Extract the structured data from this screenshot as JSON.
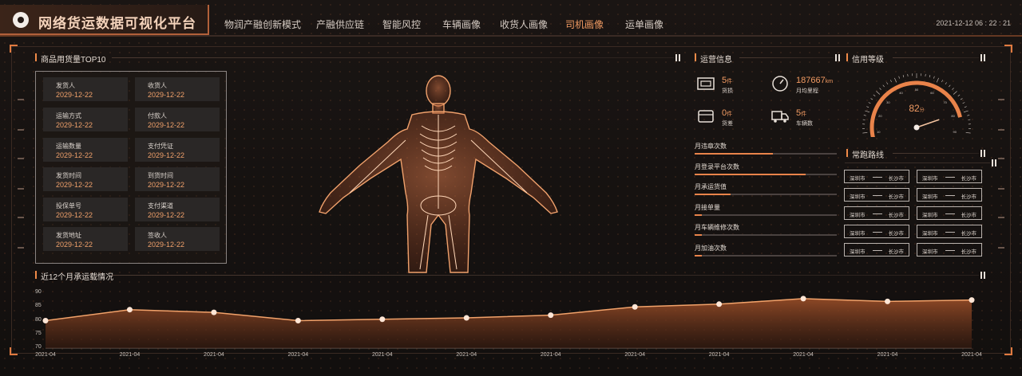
{
  "header": {
    "title": "网络货运数据可视化平台",
    "datetime": "2021-12-12 06 : 22 : 21",
    "nav": [
      {
        "label": "物润产融创新模式",
        "active": false
      },
      {
        "label": "产融供应链",
        "active": false
      },
      {
        "label": "智能风控",
        "active": false
      },
      {
        "label": "车辆画像",
        "active": false
      },
      {
        "label": "收货人画像",
        "active": false
      },
      {
        "label": "司机画像",
        "active": true
      },
      {
        "label": "运单画像",
        "active": false
      }
    ]
  },
  "left_panel": {
    "title": "商品用货量TOP10",
    "cards": [
      {
        "key": "发货人",
        "value": "2029-12-22"
      },
      {
        "key": "收货人",
        "value": "2029-12-22"
      },
      {
        "key": "运输方式",
        "value": "2029-12-22"
      },
      {
        "key": "付款人",
        "value": "2029-12-22"
      },
      {
        "key": "运输数量",
        "value": "2029-12-22"
      },
      {
        "key": "支付凭证",
        "value": "2029-12-22"
      },
      {
        "key": "发货时间",
        "value": "2029-12-22"
      },
      {
        "key": "到货时间",
        "value": "2029-12-22"
      },
      {
        "key": "投保单号",
        "value": "2029-12-22"
      },
      {
        "key": "支付渠道",
        "value": "2029-12-22"
      },
      {
        "key": "发货地址",
        "value": "2029-12-22"
      },
      {
        "key": "签收人",
        "value": "2029-12-22"
      }
    ]
  },
  "ops": {
    "title": "运营信息",
    "stats": [
      {
        "icon": "id-card-icon",
        "value": "5",
        "unit": "件",
        "label": "货损"
      },
      {
        "icon": "speedometer-icon",
        "value": "187667",
        "unit": "km",
        "label": "月均里程"
      },
      {
        "icon": "wallet-icon",
        "value": "0",
        "unit": "件",
        "label": "货差"
      },
      {
        "icon": "truck-icon",
        "value": "5",
        "unit": "件",
        "label": "车辆数"
      }
    ],
    "bars": [
      {
        "label": "月违章次数",
        "fraction": 0.55
      },
      {
        "label": "月登录平台次数",
        "fraction": 0.78
      },
      {
        "label": "月承运货值",
        "fraction": 0.25
      },
      {
        "label": "月接单量",
        "fraction": 0.05
      },
      {
        "label": "月车辆维修次数",
        "fraction": 0.05
      },
      {
        "label": "月加油次数",
        "fraction": 0.05
      }
    ]
  },
  "credit": {
    "title": "信用等级",
    "score": "82",
    "score_unit": "分",
    "score_value": 82,
    "gauge_min": 0,
    "gauge_max": 100,
    "ticks": [
      "0",
      "10",
      "20",
      "30",
      "40",
      "50",
      "60",
      "70",
      "80",
      "90",
      "100"
    ]
  },
  "routes": {
    "title": "常跑路线",
    "items": [
      {
        "from": "深圳市",
        "to": "长沙市"
      },
      {
        "from": "深圳市",
        "to": "长沙市"
      },
      {
        "from": "深圳市",
        "to": "长沙市"
      },
      {
        "from": "深圳市",
        "to": "长沙市"
      },
      {
        "from": "深圳市",
        "to": "长沙市"
      },
      {
        "from": "深圳市",
        "to": "长沙市"
      },
      {
        "from": "深圳市",
        "to": "长沙市"
      },
      {
        "from": "深圳市",
        "to": "长沙市"
      },
      {
        "from": "深圳市",
        "to": "长沙市"
      },
      {
        "from": "深圳市",
        "to": "长沙市"
      }
    ]
  },
  "chart_data": {
    "type": "area",
    "title": "近12个月承运载情况",
    "categories": [
      "2021-04",
      "2021-04",
      "2021-04",
      "2021-04",
      "2021-04",
      "2021-04",
      "2021-04",
      "2021-04",
      "2021-04",
      "2021-04",
      "2021-04",
      "2021-04"
    ],
    "series": [
      {
        "values": [
          80,
          84,
          83,
          80,
          80.5,
          81,
          82,
          85,
          86,
          88,
          87,
          87.5
        ]
      }
    ],
    "yticks": [
      "90",
      "85",
      "80",
      "75",
      "70"
    ],
    "ylim": [
      70,
      90
    ],
    "grid": false,
    "colors": {
      "line": "#f2a26a",
      "fill": "#8a4422",
      "point": "#ffe6d6"
    }
  },
  "colors": {
    "accent": "#f09a62",
    "orange": "#e9834a"
  }
}
